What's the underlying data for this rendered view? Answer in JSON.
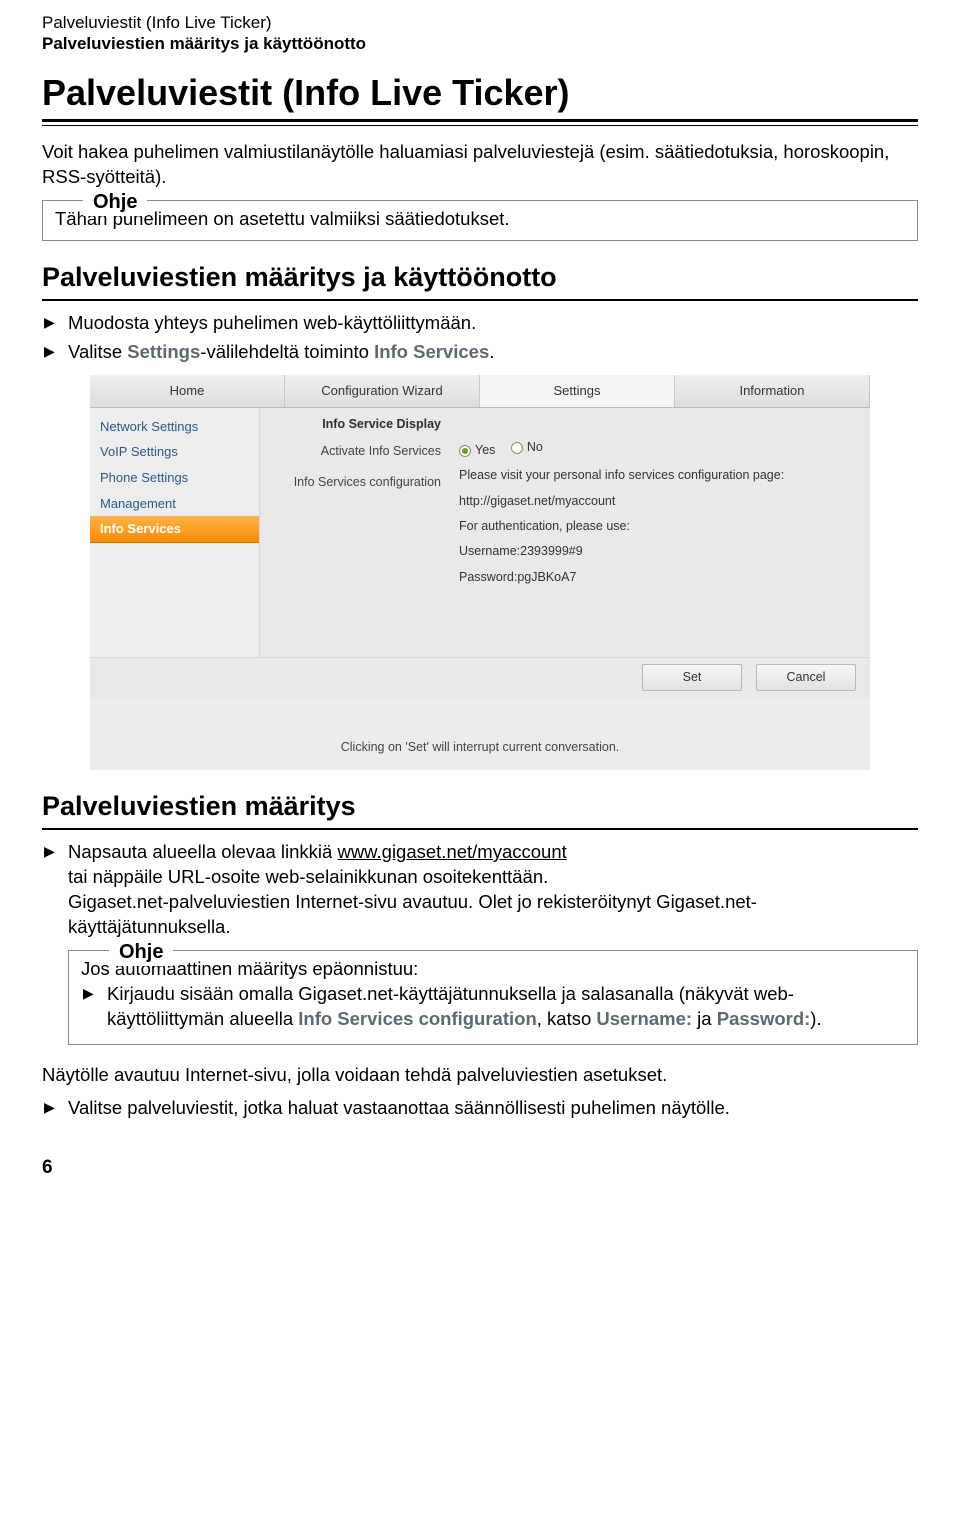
{
  "header": {
    "line1": "Palveluviestit (Info Live Ticker)",
    "line2": "Palveluviestien määritys ja käyttöönotto"
  },
  "h1": "Palveluviestit (Info Live Ticker)",
  "intro": "Voit hakea puhelimen valmiustilanäytölle haluamiasi palveluviestejä (esim. säätiedotuksia, horoskoopin, RSS-syötteitä).",
  "ohje1": {
    "legend": "Ohje",
    "text": "Tähän puhelimeen on asetettu valmiiksi säätiedotukset."
  },
  "h2a": "Palveluviestien määritys ja käyttöönotto",
  "bulletsA": {
    "b1": "Muodosta yhteys puhelimen web-käyttöliittymään.",
    "b2_pre": "Valitse ",
    "b2_settings": "Settings",
    "b2_mid": "-välilehdeltä toiminto ",
    "b2_info": "Info Services",
    "b2_post": "."
  },
  "webui": {
    "tabs": {
      "home": "Home",
      "wizard": "Configuration Wizard",
      "settings": "Settings",
      "info": "Information"
    },
    "side": {
      "net": "Network Settings",
      "voip": "VoIP Settings",
      "phone": "Phone Settings",
      "mgmt": "Management",
      "infoserv": "Info Services"
    },
    "mid": {
      "heading": "Info Service Display",
      "activate": "Activate Info Services",
      "config": "Info Services configuration"
    },
    "right": {
      "yes": "Yes",
      "no": "No",
      "visit": "Please visit your personal info services configuration page:",
      "url": "http://gigaset.net/myaccount",
      "auth": "For authentication, please use:",
      "user": "Username:2393999#9",
      "pass": "Password:pgJBKoA7"
    },
    "buttons": {
      "set": "Set",
      "cancel": "Cancel"
    },
    "footer": "Clicking on 'Set' will interrupt current conversation."
  },
  "h2b": "Palveluviestien määritys",
  "bulletsB": {
    "b1_pre": "Napsauta alueella olevaa linkkiä ",
    "b1_link": "www.gigaset.net/myaccount",
    "b1_line2": "tai näppäile URL-osoite web-selainikkunan osoitekenttään.",
    "b1_line3": "Gigaset.net-palveluviestien Internet-sivu avautuu. Olet jo rekisteröitynyt Gigaset.net-käyttäjätunnuksella."
  },
  "ohje2": {
    "legend": "Ohje",
    "intro": "Jos automaattinen määritys epäonnistuu:",
    "b1_pre": "Kirjaudu sisään omalla Gigaset.net-käyttäjätunnuksella ja salasanalla (näkyvät web-käyttöliittymän alueella ",
    "b1_cfg": "Info Services configuration",
    "b1_mid": ", katso ",
    "b1_user": "Username:",
    "b1_and": " ja ",
    "b1_pass": "Password:",
    "b1_post": ")."
  },
  "tail": {
    "p1": "Näytölle avautuu Internet-sivu, jolla voidaan tehdä palveluviestien asetukset.",
    "b1": "Valitse palveluviestit, jotka haluat vastaanottaa säännöllisesti puhelimen näytölle."
  },
  "pagenum": "6"
}
